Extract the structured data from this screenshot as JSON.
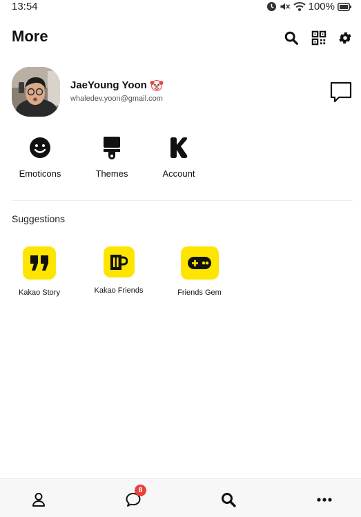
{
  "status_bar": {
    "time": "13:54",
    "battery": "100%"
  },
  "header": {
    "title": "More"
  },
  "profile": {
    "name": "JaeYoung Yoon",
    "email": "whaledev.yoon@gmail.com"
  },
  "quick_actions": [
    {
      "label": "Emoticons",
      "icon": "smiley-icon"
    },
    {
      "label": "Themes",
      "icon": "paint-brush-icon"
    },
    {
      "label": "Account",
      "icon": "kakao-k-icon"
    }
  ],
  "suggestions": {
    "title": "Suggestions",
    "items": [
      {
        "label": "Kakao Story",
        "icon": "quote-icon"
      },
      {
        "label": "Kakao Friends",
        "icon": "mug-icon"
      },
      {
        "label": "Friends Gem",
        "icon": "gamepad-icon"
      }
    ]
  },
  "bottom_nav": {
    "chats_badge": "8"
  },
  "colors": {
    "accent": "#fee500",
    "badge": "#e8423f"
  }
}
